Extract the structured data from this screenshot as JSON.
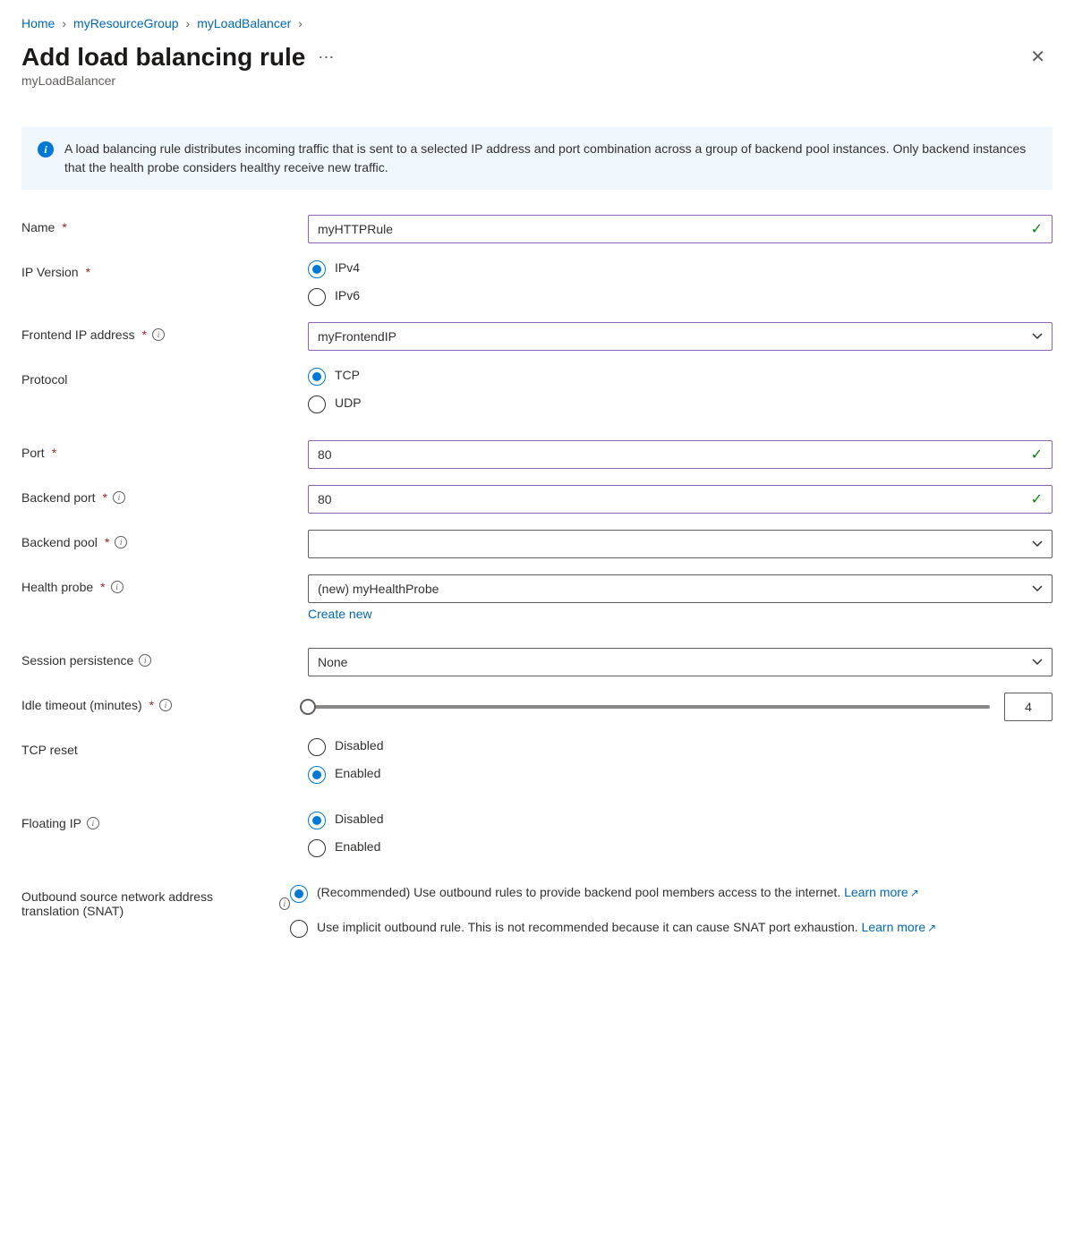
{
  "breadcrumb": {
    "home": "Home",
    "group": "myResourceGroup",
    "lb": "myLoadBalancer"
  },
  "header": {
    "title": "Add load balancing rule",
    "subtitle": "myLoadBalancer"
  },
  "banner": {
    "text": "A load balancing rule distributes incoming traffic that is sent to a selected IP address and port combination across a group of backend pool instances. Only backend instances that the health probe considers healthy receive new traffic."
  },
  "labels": {
    "name": "Name",
    "ip_version": "IP Version",
    "frontend_ip": "Frontend IP address",
    "protocol": "Protocol",
    "port": "Port",
    "backend_port": "Backend port",
    "backend_pool": "Backend pool",
    "health_probe": "Health probe",
    "session_persistence": "Session persistence",
    "idle_timeout": "Idle timeout (minutes)",
    "tcp_reset": "TCP reset",
    "floating_ip": "Floating IP",
    "snat": "Outbound source network address translation (SNAT)"
  },
  "values": {
    "name": "myHTTPRule",
    "ip_version": {
      "ipv4": "IPv4",
      "ipv6": "IPv6",
      "selected": "ipv4"
    },
    "frontend_ip": "myFrontendIP",
    "protocol": {
      "tcp": "TCP",
      "udp": "UDP",
      "selected": "tcp"
    },
    "port": "80",
    "backend_port": "80",
    "backend_pool": "",
    "health_probe": "(new) myHealthProbe",
    "create_new": "Create new",
    "session_persistence": "None",
    "idle_timeout": "4",
    "tcp_reset": {
      "disabled": "Disabled",
      "enabled": "Enabled",
      "selected": "enabled"
    },
    "floating_ip": {
      "disabled": "Disabled",
      "enabled": "Enabled",
      "selected": "disabled"
    },
    "snat": {
      "recommended": "(Recommended) Use outbound rules to provide backend pool members access to the internet. ",
      "implicit": "Use implicit outbound rule. This is not recommended because it can cause SNAT port exhaustion. ",
      "learn_more": "Learn more",
      "selected": "recommended"
    }
  }
}
